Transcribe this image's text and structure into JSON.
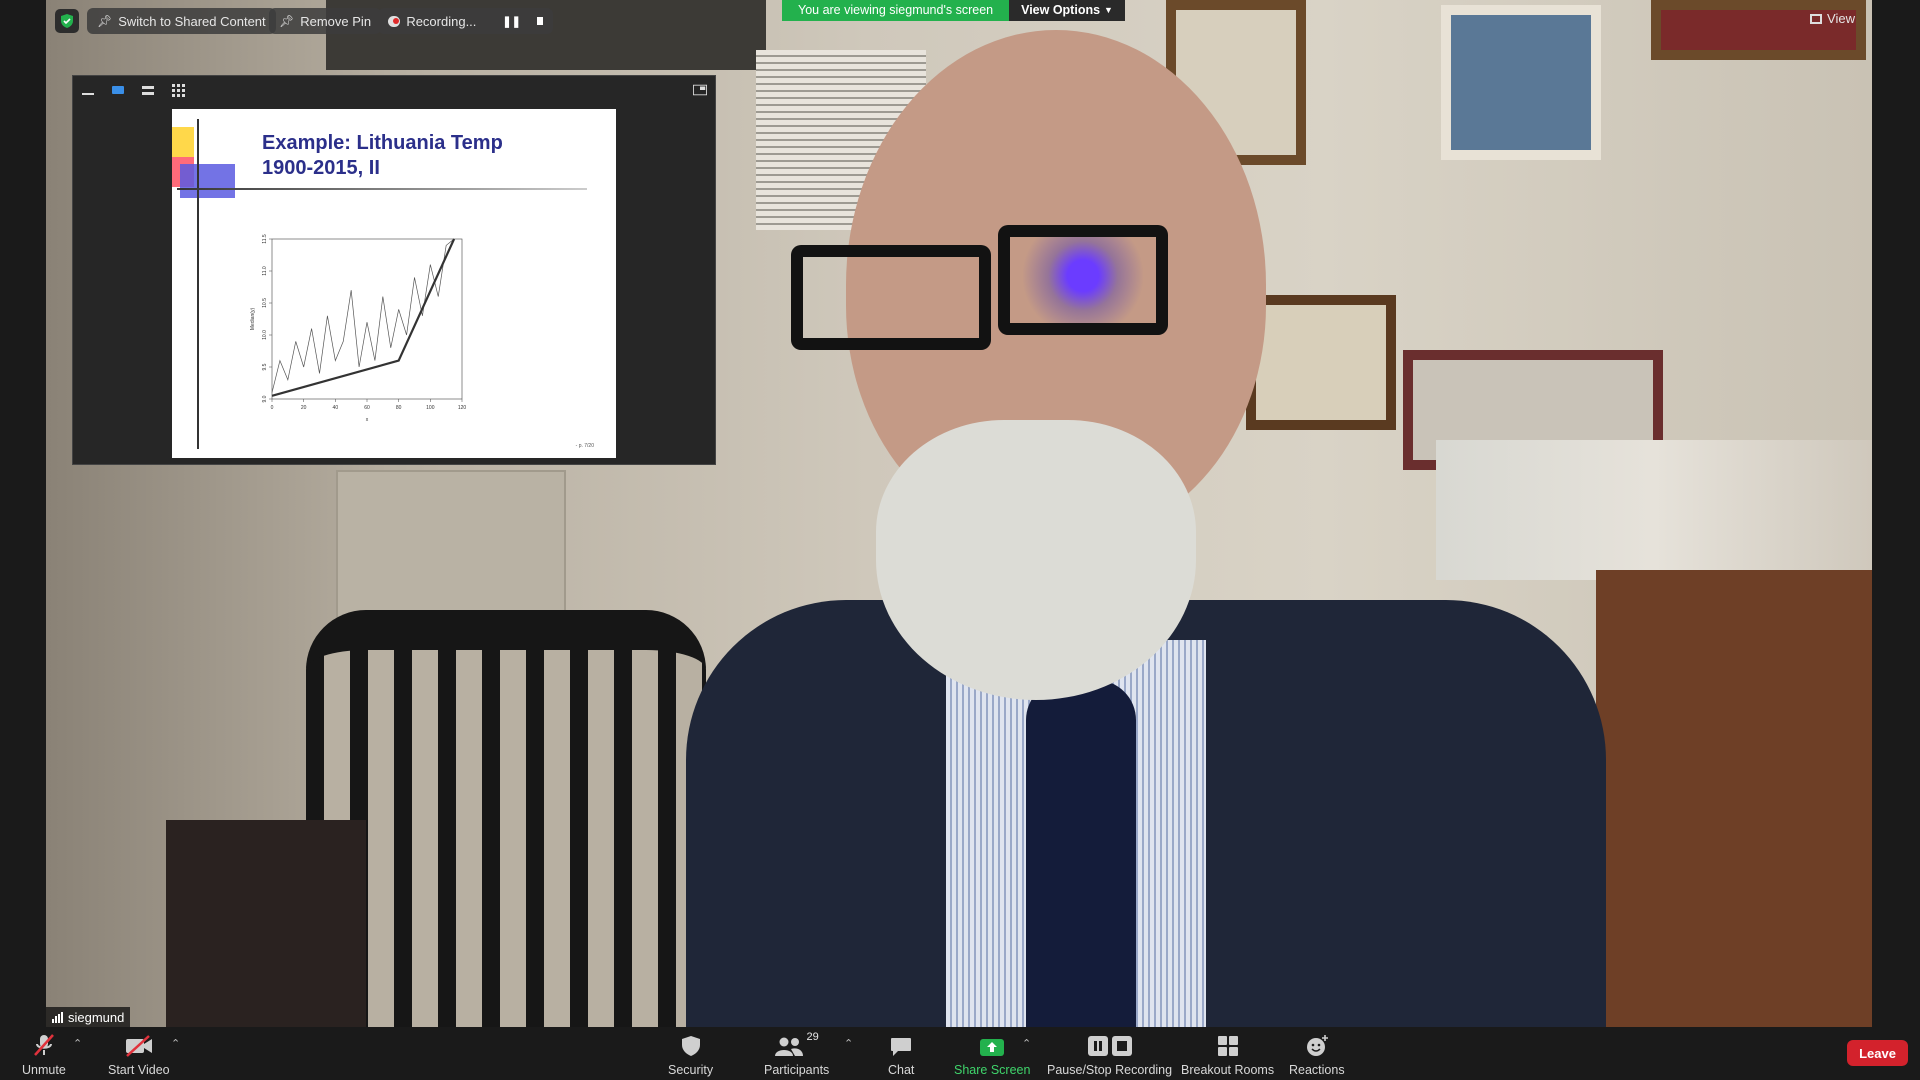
{
  "top_bar": {
    "switch_label": "Switch to Shared Content",
    "remove_pin_label": "Remove Pin",
    "recording_label": "Recording...",
    "viewing_banner": "You are viewing siegmund's screen",
    "view_options_label": "View Options",
    "view_label": "View"
  },
  "slide": {
    "title_line1": "Example: Lithuania Temp",
    "title_line2": "1900-2015, II",
    "footer": "- p. 7/20"
  },
  "chart_data": {
    "type": "line",
    "title": "",
    "xlabel": "x",
    "ylabel": "Median(y)",
    "xlim": [
      0,
      120
    ],
    "ylim": [
      9.0,
      11.5
    ],
    "x_ticks": [
      "0",
      "20",
      "40",
      "60",
      "80",
      "100",
      "120"
    ],
    "y_ticks": [
      "9.0",
      "9.5",
      "10.0",
      "10.5",
      "11.0",
      "11.5"
    ],
    "series": [
      {
        "values_x": [
          0,
          5,
          10,
          15,
          20,
          25,
          30,
          35,
          40,
          45,
          50,
          55,
          60,
          65,
          70,
          75,
          80,
          85,
          90,
          95,
          100,
          105,
          110,
          115
        ],
        "values_y": [
          9.1,
          9.6,
          9.3,
          9.9,
          9.5,
          10.1,
          9.4,
          10.3,
          9.6,
          9.9,
          10.7,
          9.5,
          10.2,
          9.6,
          10.6,
          9.8,
          10.4,
          10.0,
          10.9,
          10.3,
          11.1,
          10.6,
          11.4,
          11.5
        ]
      },
      {
        "values_x": [
          0,
          80,
          115
        ],
        "values_y": [
          9.05,
          9.6,
          11.5
        ]
      }
    ]
  },
  "participant": {
    "name": "siegmund"
  },
  "toolbar": {
    "unmute": "Unmute",
    "start_video": "Start Video",
    "security": "Security",
    "participants": "Participants",
    "participants_count": "29",
    "chat": "Chat",
    "share_screen": "Share Screen",
    "pause_stop": "Pause/Stop Recording",
    "breakout": "Breakout Rooms",
    "reactions": "Reactions",
    "leave": "Leave"
  },
  "colors": {
    "banner_green": "#23b14d",
    "leave_red": "#d3222c",
    "share_green": "#23b14d",
    "slide_title": "#2b2f8a"
  }
}
